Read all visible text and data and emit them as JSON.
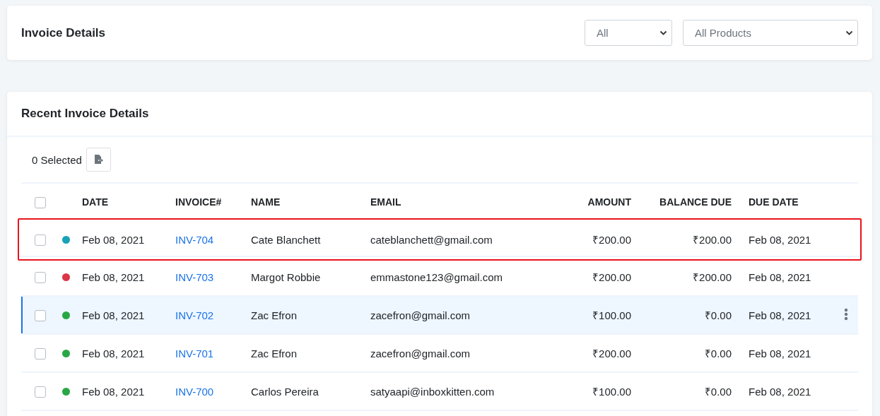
{
  "header": {
    "title": "Invoice Details",
    "filters": [
      {
        "value": "All"
      },
      {
        "value": "All Products"
      }
    ]
  },
  "recent": {
    "title": "Recent Invoice Details",
    "selected_count": "0 Selected",
    "select_all": {
      "checked": false
    },
    "columns": [
      "DATE",
      "INVOICE#",
      "NAME",
      "EMAIL",
      "AMOUNT",
      "BALANCE DUE",
      "DUE DATE"
    ],
    "rows": [
      {
        "checked": false,
        "color": "#17a2b8",
        "date": "Feb 08, 2021",
        "invoice": "INV-704",
        "name": "Cate Blanchett",
        "email": "cateblanchett@gmail.com",
        "amount": "₹200.00",
        "balance_due": "₹200.00",
        "due_date": "Feb 08, 2021",
        "highlighted": true,
        "hovered": false
      },
      {
        "checked": false,
        "color": "#dc3545",
        "date": "Feb 08, 2021",
        "invoice": "INV-703",
        "name": "Margot Robbie",
        "email": "emmastone123@gmail.com",
        "amount": "₹200.00",
        "balance_due": "₹200.00",
        "due_date": "Feb 08, 2021",
        "highlighted": false,
        "hovered": false
      },
      {
        "checked": false,
        "color": "#28a745",
        "date": "Feb 08, 2021",
        "invoice": "INV-702",
        "name": "Zac Efron",
        "email": "zacefron@gmail.com",
        "amount": "₹100.00",
        "balance_due": "₹0.00",
        "due_date": "Feb 08, 2021",
        "highlighted": false,
        "hovered": true
      },
      {
        "checked": false,
        "color": "#28a745",
        "date": "Feb 08, 2021",
        "invoice": "INV-701",
        "name": "Zac Efron",
        "email": "zacefron@gmail.com",
        "amount": "₹200.00",
        "balance_due": "₹0.00",
        "due_date": "Feb 08, 2021",
        "highlighted": false,
        "hovered": false
      },
      {
        "checked": false,
        "color": "#28a745",
        "date": "Feb 08, 2021",
        "invoice": "INV-700",
        "name": "Carlos Pereira",
        "email": "satyaapi@inboxkitten.com",
        "amount": "₹100.00",
        "balance_due": "₹0.00",
        "due_date": "Feb 08, 2021",
        "highlighted": false,
        "hovered": false
      }
    ]
  }
}
